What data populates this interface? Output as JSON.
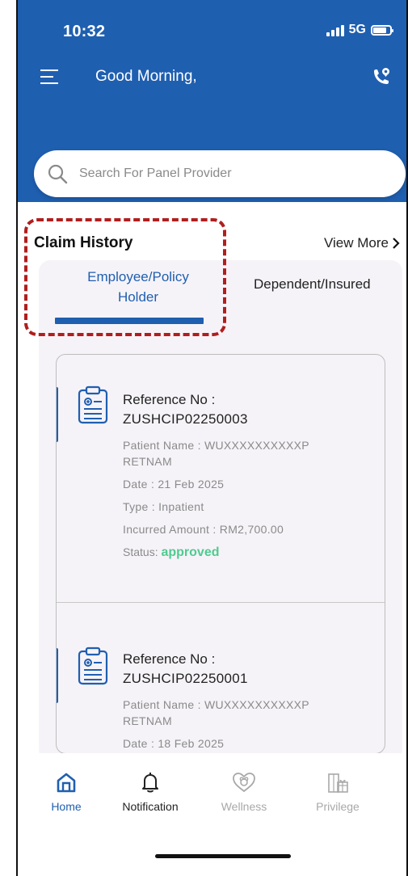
{
  "status_bar": {
    "time": "10:32",
    "network": "5G"
  },
  "header": {
    "greeting": "Good Morning,"
  },
  "search": {
    "placeholder": "Search For Panel Provider"
  },
  "claim_history": {
    "title": "Claim History",
    "view_more": "View More",
    "tabs": [
      {
        "label": "Employee/Policy Holder",
        "line1": "Employee/Policy",
        "line2": "Holder",
        "active": true
      },
      {
        "label": "Dependent/Insured",
        "active": false
      }
    ],
    "claims": [
      {
        "ref_label": "Reference No :",
        "ref_no": "ZUSHCIP02250003",
        "patient_line1": "Patient Name : WUXXXXXXXXXXP",
        "patient_line2": "RETNAM",
        "date": "Date : 21 Feb 2025",
        "type": "Type : Inpatient",
        "amount": "Incurred Amount : RM2,700.00",
        "status_label": "Status:",
        "status_value": "approved"
      },
      {
        "ref_label": "Reference No :",
        "ref_no": "ZUSHCIP02250001",
        "patient_line1": "Patient Name : WUXXXXXXXXXXP",
        "patient_line2": "RETNAM",
        "date": "Date : 18 Feb 2025"
      }
    ]
  },
  "nav": [
    {
      "label": "Home",
      "icon": "home-icon",
      "active": true
    },
    {
      "label": "Notification",
      "icon": "bell-icon",
      "active": false
    },
    {
      "label": "Wellness",
      "icon": "wellness-icon",
      "active": false
    },
    {
      "label": "Privilege",
      "icon": "gift-icon",
      "active": false
    }
  ],
  "colors": {
    "primary": "#1f5fb0",
    "status_approved": "#4fcb8f",
    "highlight": "#b01e1e",
    "inactive_nav": "#a8a8a8"
  }
}
